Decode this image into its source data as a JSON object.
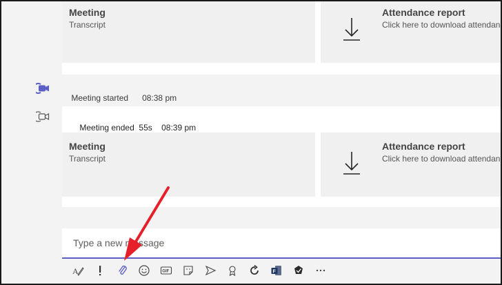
{
  "top_card": {
    "tiles": [
      {
        "title": "Meeting",
        "subtitle": "Transcript"
      },
      {
        "title": "Attendance report",
        "subtitle": "Click here to download attendance"
      }
    ]
  },
  "events": [
    {
      "text": "Meeting started",
      "time": "08:38 pm"
    }
  ],
  "bottom_card": {
    "header_text": "Meeting ended",
    "header_duration": "55s",
    "header_time": "08:39 pm",
    "tiles": [
      {
        "title": "Meeting",
        "subtitle": "Transcript"
      },
      {
        "title": "Attendance report",
        "subtitle": "Click here to download attendance"
      }
    ]
  },
  "compose": {
    "placeholder": "Type a new message"
  },
  "toolbar": {
    "buttons": [
      "format-icon",
      "important-icon",
      "attach-icon",
      "emoji-icon",
      "gif-icon",
      "sticker-icon",
      "meet-now-icon",
      "praise-icon",
      "loop-icon",
      "forms-icon",
      "approvals-icon",
      "more-icon"
    ]
  },
  "colors": {
    "accent": "#5b5fc7",
    "annotation_arrow": "#e5202a"
  }
}
